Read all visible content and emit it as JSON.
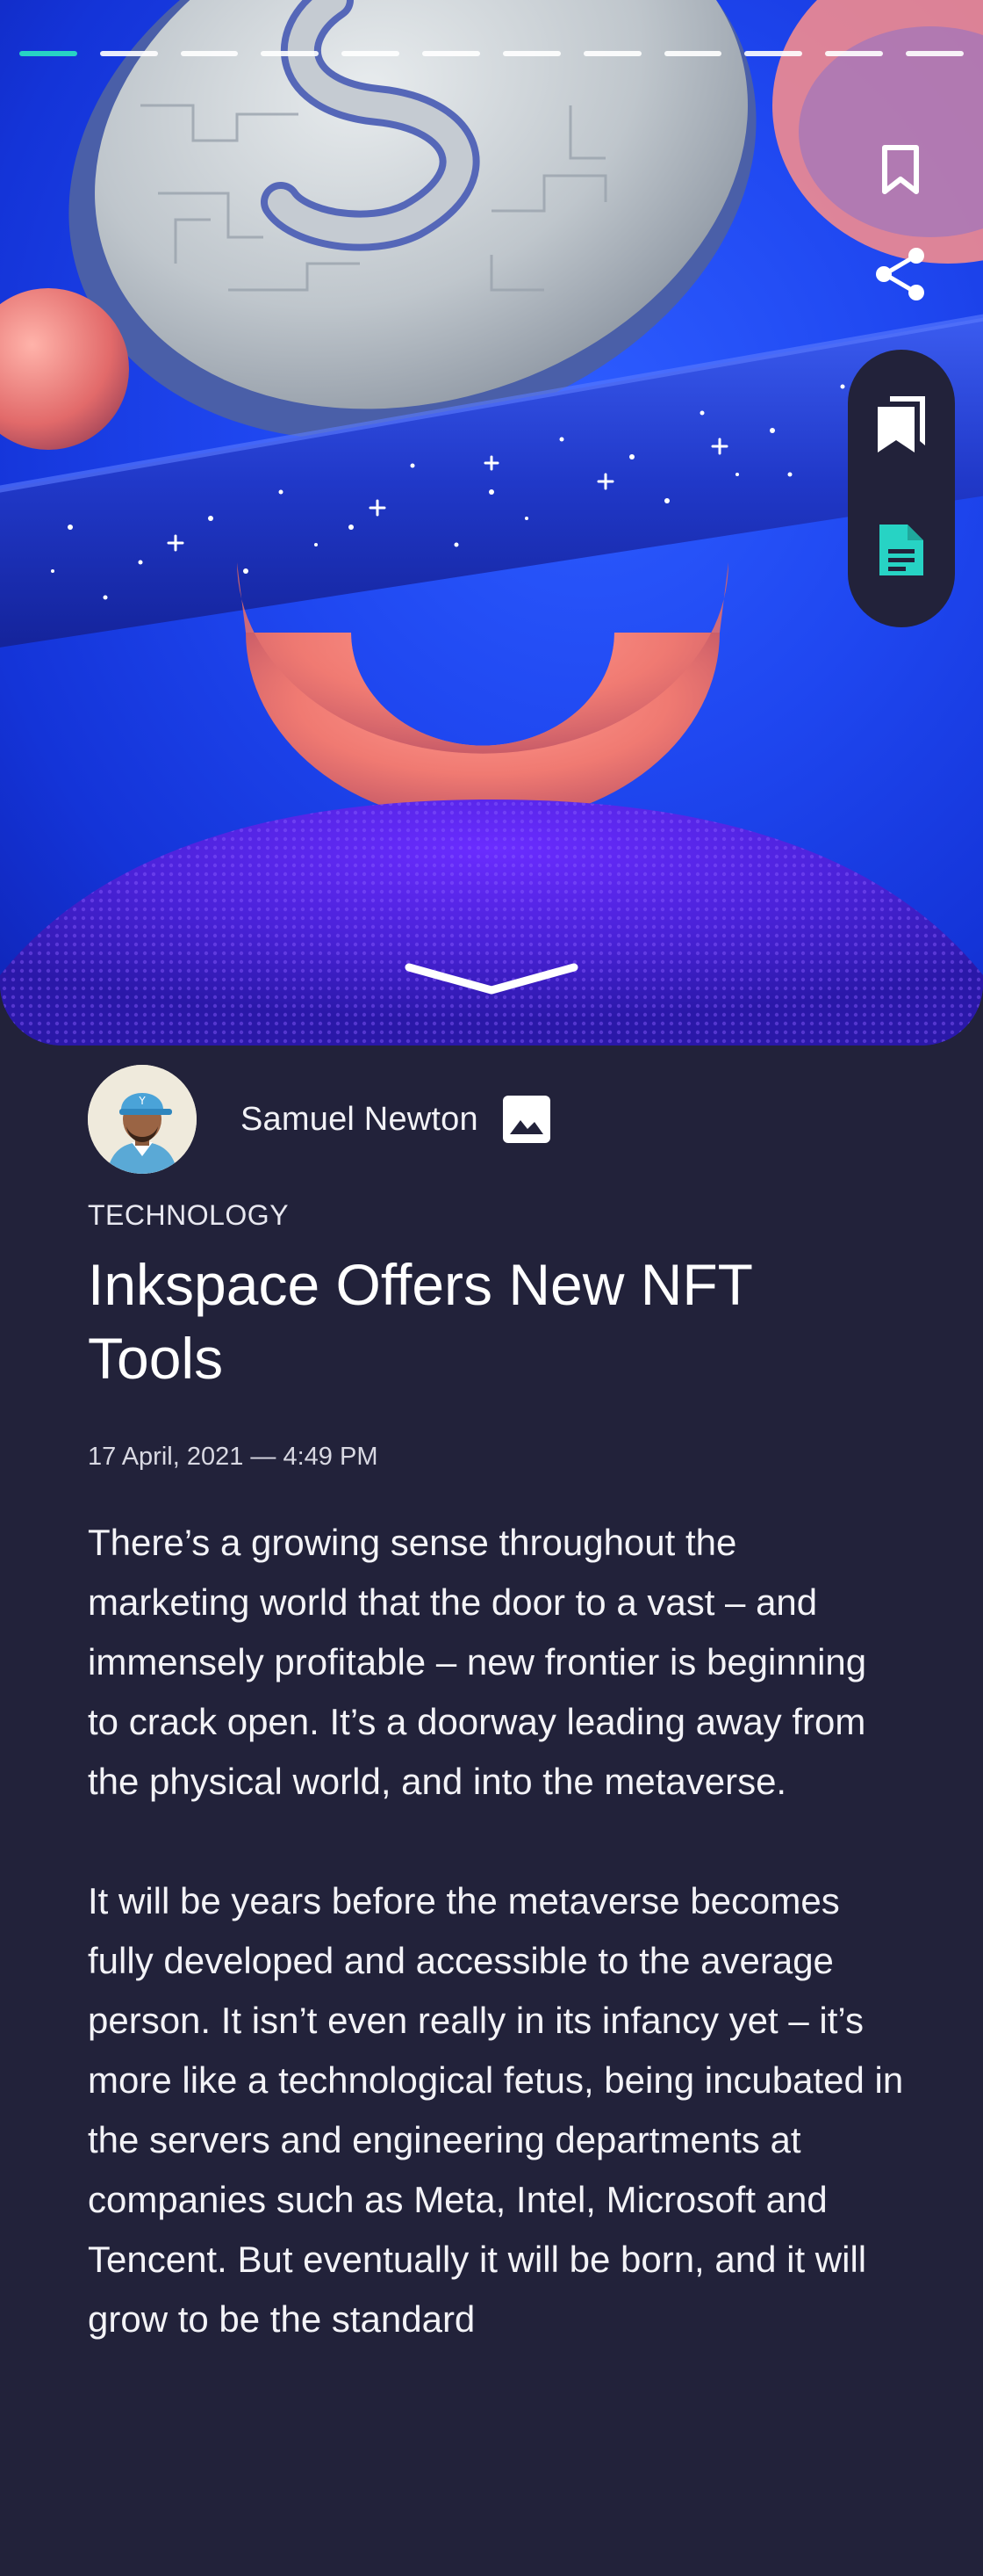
{
  "hero": {
    "story_segments": 12,
    "active_segment": 0,
    "accent_color": "#27d3c4",
    "icons": {
      "bookmark": "bookmark-icon",
      "share": "share-icon",
      "stack": "bookmarks-stack-icon",
      "document": "document-icon",
      "expand": "chevron-down-icon"
    }
  },
  "author": {
    "name": "Samuel Newton",
    "avatar": "avatar",
    "media_icon": "image-icon"
  },
  "article": {
    "category": "TECHNOLOGY",
    "title": "Inkspace Offers New NFT Tools",
    "date": "17 April, 2021 — 4:49 PM",
    "paragraphs": [
      "There’s a growing sense throughout the marketing world that the door to a vast – and immensely profitable – new frontier is beginning to crack open. It’s a doorway leading away from the physical world, and into the metaverse.",
      "It will be years before the metaverse becomes fully developed and accessible to the average person. It isn’t even really in its infancy yet – it’s more like a technological fetus, being incubated in the servers and engineering departments at companies such as Meta, Intel, Microsoft and Tencent. But eventually it will be born, and it will grow to be the standard"
    ]
  },
  "colors": {
    "background": "#22223a",
    "hero_blue": "#1f47f0",
    "accent": "#27d3c4"
  }
}
